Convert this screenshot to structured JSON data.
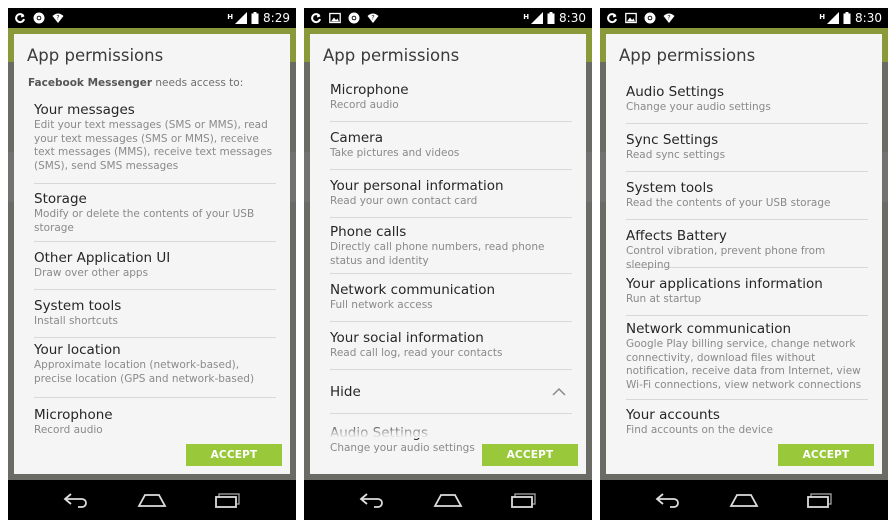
{
  "statusbar": {
    "time1": "8:29",
    "time2": "8:30",
    "time3": "8:30",
    "network": "H"
  },
  "dialog_title": "App permissions",
  "accept_label": "ACCEPT",
  "screen1": {
    "app_name": "Facebook Messenger",
    "needs_suffix": " needs access to:",
    "perms": [
      {
        "title": "Your messages",
        "desc": "Edit your text messages (SMS or MMS), read your text messages (SMS or MMS), receive text messages (MMS), receive text messages (SMS), send SMS messages"
      },
      {
        "title": "Storage",
        "desc": "Modify or delete the contents of your USB storage"
      },
      {
        "title": "Other Application UI",
        "desc": "Draw over other apps"
      },
      {
        "title": "System tools",
        "desc": "Install shortcuts"
      },
      {
        "title": "Your location",
        "desc": "Approximate location (network-based), precise location (GPS and network-based)"
      },
      {
        "title": "Microphone",
        "desc": "Record audio"
      }
    ]
  },
  "screen2": {
    "perms": [
      {
        "title": "Microphone",
        "desc": "Record audio"
      },
      {
        "title": "Camera",
        "desc": "Take pictures and videos"
      },
      {
        "title": "Your personal information",
        "desc": "Read your own contact card"
      },
      {
        "title": "Phone calls",
        "desc": "Directly call phone numbers, read phone status and identity"
      },
      {
        "title": "Network communication",
        "desc": "Full network access"
      },
      {
        "title": "Your social information",
        "desc": "Read call log, read your contacts"
      }
    ],
    "hide_label": "Hide",
    "extra": {
      "title": "Audio Settings",
      "desc": "Change your audio settings"
    }
  },
  "screen3": {
    "perms": [
      {
        "title": "Audio Settings",
        "desc": "Change your audio settings"
      },
      {
        "title": "Sync Settings",
        "desc": "Read sync settings"
      },
      {
        "title": "System tools",
        "desc": "Read the contents of your USB storage"
      },
      {
        "title": "Affects Battery",
        "desc": "Control vibration, prevent phone from sleeping"
      },
      {
        "title": "Your applications information",
        "desc": "Run at startup"
      },
      {
        "title": "Network communication",
        "desc": "Google Play billing service, change network connectivity, download files without notification, receive data from Internet, view Wi-Fi connections, view network connections"
      },
      {
        "title": "Your accounts",
        "desc": "Find accounts on the device"
      }
    ]
  },
  "icons": [
    "sync-icon",
    "chrome-icon",
    "wifi-icon",
    "image-icon",
    "signal-icon",
    "battery-icon",
    "back-icon",
    "home-icon",
    "recents-icon",
    "chevron-up-icon"
  ],
  "colors": {
    "accept": "#99c93a",
    "appbar": "#8a9a3a",
    "dialog": "#f5f5f5"
  }
}
